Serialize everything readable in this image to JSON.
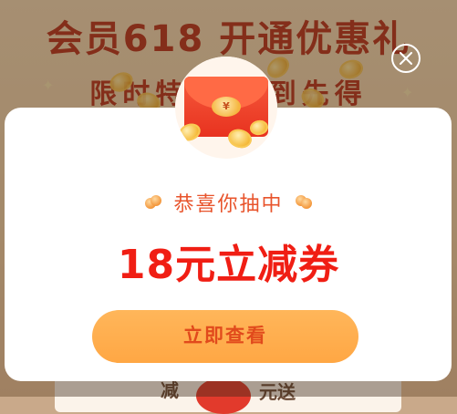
{
  "background": {
    "title": "会员618 开通优惠礼",
    "subtitle": "限时特惠 抢到先得",
    "bottom_left_char": "减",
    "bottom_right_text": "元送"
  },
  "modal": {
    "congrats_text": "恭喜你抽中",
    "coupon_title": "18元立减券",
    "view_button_label": "立即查看",
    "packet_seal_symbol": "¥"
  },
  "icons": {
    "close": "close-icon",
    "packet": "red-packet-icon"
  },
  "colors": {
    "accent_red": "#f01e14",
    "congrats_orange": "#e8542c",
    "button_bg": "#ffa744",
    "button_text": "#e14a1c"
  }
}
